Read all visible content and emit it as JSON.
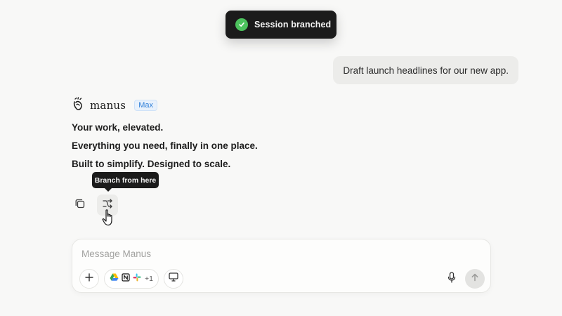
{
  "toast": {
    "text": "Session branched"
  },
  "user_message": {
    "text": "Draft launch headlines for our new app."
  },
  "assistant": {
    "name": "manus",
    "plan_badge": "Max",
    "lines": [
      "Your work, elevated.",
      "Everything you need, finally in one place.",
      "Built to simplify. Designed to scale."
    ]
  },
  "tooltip": {
    "text": "Branch from here"
  },
  "composer": {
    "placeholder": "Message Manus",
    "connectors_more": "+1"
  },
  "colors": {
    "toast_bg": "#1b1b1b",
    "success": "#4cc25d",
    "badge": "#2f7fd8",
    "background": "#f8f8f7"
  },
  "icons": [
    "check-icon",
    "manus-logo-icon",
    "copy-icon",
    "branch-icon",
    "hand-cursor-icon",
    "plus-icon",
    "google-drive-icon",
    "notion-icon",
    "slack-icon",
    "monitor-icon",
    "microphone-icon",
    "arrow-up-icon"
  ]
}
